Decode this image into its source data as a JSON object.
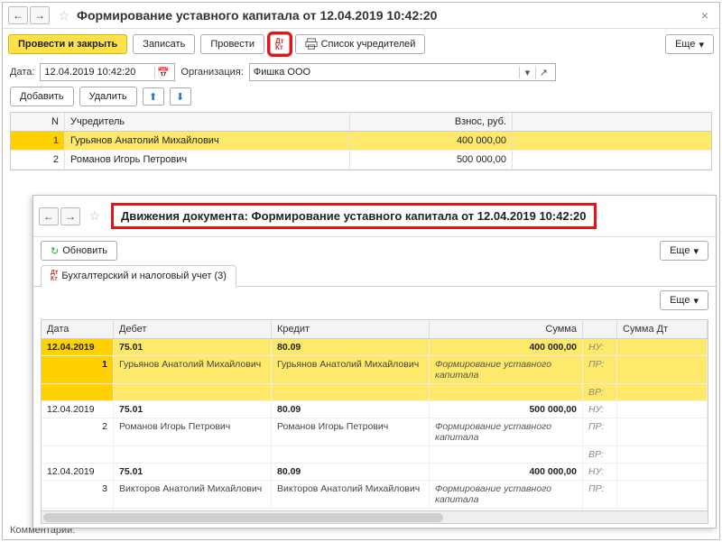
{
  "win1": {
    "title": "Формирование уставного капитала от 12.04.2019 10:42:20",
    "toolbar": {
      "post_close": "Провести и закрыть",
      "save": "Записать",
      "post": "Провести",
      "founders": "Список учредителей",
      "more": "Еще"
    },
    "form": {
      "date_label": "Дата:",
      "date_value": "12.04.2019 10:42:20",
      "org_label": "Организация:",
      "org_value": "Фишка ООО"
    },
    "tbuttons": {
      "add": "Добавить",
      "del": "Удалить"
    },
    "cols": {
      "n": "N",
      "founder": "Учредитель",
      "amount": "Взнос, руб."
    },
    "rows": [
      {
        "n": "1",
        "founder": "Гурьянов Анатолий Михайлович",
        "amount": "400 000,00"
      },
      {
        "n": "2",
        "founder": "Романов Игорь Петрович",
        "amount": "500 000,00"
      }
    ],
    "comment_label": "Комментарий:"
  },
  "win2": {
    "title": "Движения документа: Формирование уставного капитала от 12.04.2019 10:42:20",
    "refresh": "Обновить",
    "more": "Еще",
    "tab": "Бухгалтерский и налоговый учет (3)",
    "cols": {
      "date": "Дата",
      "debit": "Дебет",
      "credit": "Кредит",
      "sum": "Сумма",
      "sumdt": "Сумма Дт"
    },
    "labels": {
      "nu": "НУ:",
      "pr": "ПР:",
      "vr": "ВР:"
    },
    "entries": [
      {
        "date": "12.04.2019",
        "idx": "1",
        "debit_acc": "75.01",
        "credit_acc": "80.09",
        "sum": "400 000,00",
        "debit_sub": "Гурьянов Анатолий Михайлович",
        "credit_sub": "Гурьянов Анатолий Михайлович",
        "desc": "Формирование уставного капитала"
      },
      {
        "date": "12.04.2019",
        "idx": "2",
        "debit_acc": "75.01",
        "credit_acc": "80.09",
        "sum": "500 000,00",
        "debit_sub": "Романов Игорь Петрович",
        "credit_sub": "Романов Игорь Петрович",
        "desc": "Формирование уставного капитала"
      },
      {
        "date": "12.04.2019",
        "idx": "3",
        "debit_acc": "75.01",
        "credit_acc": "80.09",
        "sum": "400 000,00",
        "debit_sub": "Викторов Анатолий Михайлович",
        "credit_sub": "Викторов Анатолий Михайлович",
        "desc": "Формирование уставного капитала"
      }
    ]
  }
}
